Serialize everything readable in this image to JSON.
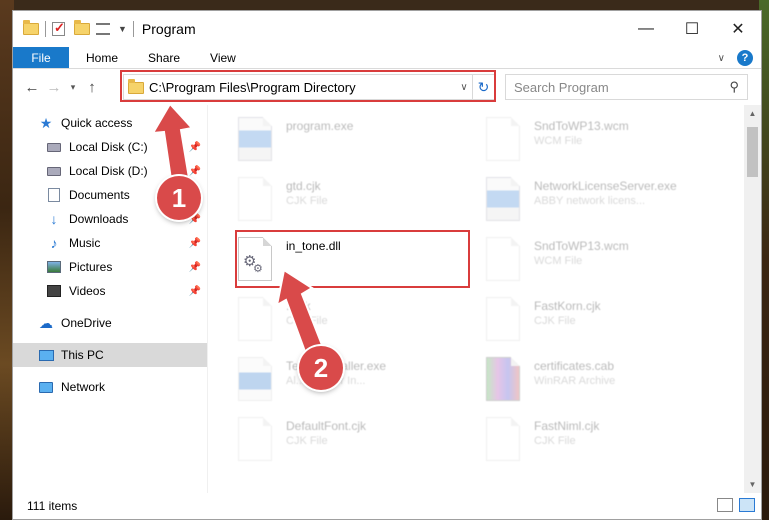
{
  "window": {
    "title": "Program",
    "controls": {
      "minimize": "—",
      "maximize": "☐",
      "close": "✕"
    }
  },
  "ribbon": {
    "tabs": [
      "File",
      "Home",
      "Share",
      "View"
    ],
    "help": "?"
  },
  "address": {
    "path": "C:\\Program Files\\Program Directory",
    "search_placeholder": "Search Program"
  },
  "sidebar": {
    "items": [
      {
        "label": "Quick access",
        "icon": "star-icon"
      },
      {
        "label": "Local Disk (C:)",
        "icon": "disk-icon",
        "pinned": true
      },
      {
        "label": "Local Disk (D:)",
        "icon": "disk-icon",
        "pinned": true
      },
      {
        "label": "Documents",
        "icon": "documents-icon",
        "pinned": true
      },
      {
        "label": "Downloads",
        "icon": "download-icon",
        "pinned": true
      },
      {
        "label": "Music",
        "icon": "music-icon",
        "pinned": true
      },
      {
        "label": "Pictures",
        "icon": "pictures-icon",
        "pinned": true
      },
      {
        "label": "Videos",
        "icon": "videos-icon",
        "pinned": true
      },
      {
        "label": "OneDrive",
        "icon": "cloud-icon"
      },
      {
        "label": "This PC",
        "icon": "computer-icon",
        "selected": true
      },
      {
        "label": "Network",
        "icon": "network-icon"
      }
    ]
  },
  "files": [
    {
      "name": "program.exe",
      "type": ""
    },
    {
      "name": "SndToWP13.wcm",
      "type": "WCM File"
    },
    {
      "name": "gtd.cjk",
      "type": "CJK File"
    },
    {
      "name": "NetworkLicenseServer.exe",
      "type": "ABBY network licens..."
    },
    {
      "name": "in_tone.dll",
      "type": ""
    },
    {
      "name": "SndToWP13.wcm",
      "type": "WCM File"
    },
    {
      "name": "...cjk",
      "type": "CJK File"
    },
    {
      "name": "FastKorn.cjk",
      "type": "CJK File"
    },
    {
      "name": "Te...ndInstaller.exe",
      "type": "Al... Reader In..."
    },
    {
      "name": "certificates.cab",
      "type": "WinRAR Archive"
    },
    {
      "name": "DefaultFont.cjk",
      "type": "CJK File"
    },
    {
      "name": "FastNiml.cjk",
      "type": "CJK File"
    }
  ],
  "status": {
    "count": "111 items"
  },
  "callouts": [
    "1",
    "2"
  ],
  "colors": {
    "accent": "#1979ca",
    "annotation": "#d93c3c"
  }
}
